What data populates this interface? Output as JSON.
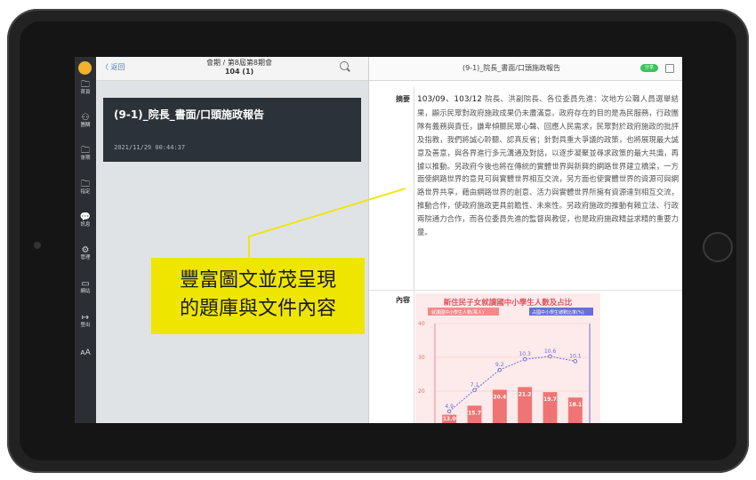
{
  "sidebar": {
    "items": [
      {
        "label": "首頁",
        "icon": "folder-icon"
      },
      {
        "label": "團購",
        "icon": "users-icon"
      },
      {
        "label": "會期",
        "icon": "folder-icon"
      },
      {
        "label": "指定",
        "icon": "folder-icon"
      },
      {
        "label": "訊息",
        "icon": "chat-icon"
      },
      {
        "label": "管理",
        "icon": "gear-icon"
      },
      {
        "label": "網站",
        "icon": "monitor-icon"
      },
      {
        "label": "登出",
        "icon": "logout-icon"
      },
      {
        "label": "",
        "icon": "font-size-icon"
      }
    ]
  },
  "list_header": {
    "back_label": "〈 返回",
    "breadcrumb_line1": "會期 / 第8屆第8期會",
    "breadcrumb_line2": "104 (1)"
  },
  "doc_card": {
    "title": "(9-1)_院長_書面/口頭施政報告",
    "date": "2021/11/29 00:44:37"
  },
  "detail": {
    "title": "(9-1)_院長_書面/口頭施政報告",
    "line_badge": "分享",
    "abstract_label": "摘要",
    "content_label": "內容",
    "abstract_lead": "103/09、103/12",
    "abstract_text": " 院長、洪副院長、各位委員先進：次地方公職人員選舉結果，顯示民眾對政府施政成果仍未盡滿意。政府存在的目的是為民服務，行政團隊有義務與責任，謙卑傾聽民眾心聲、回應人民需求，民眾對於政府施政的批評及指教，我們將誠心聆聽、認真反省；針對具重大爭議的政策，也將展現最大誠意及善意，與各界進行多元溝通及對話，以逐步凝聚並尋求政策的最大共識，再據以推動。另政府今後也將在傳統的實體世界與新興的網路世界建立橋梁，一方面使網路世界的意見可與實體世界相互交流，另方面也使實體世界的資源可與網路世界共享，藉由網路世界的創意、活力與實體世界所擁有資源達到相互交流，推動合作，使政府施政更具前瞻性、未來性。另政府施政的推動有賴立法、行政兩院通力合作，而各位委員先進的監督與教促，也是政府施政精益求精的重要力量。"
  },
  "chart_image": {
    "title": "新住民子女就讀國中小學生人數及占比",
    "legend_left": "就讀國中小學生人數(萬人)",
    "legend_right": "占國中小學生總數比率(%)"
  },
  "chart_data": {
    "type": "bar",
    "title": "新住民子女就讀國中小學生人數及占比",
    "series": [
      {
        "name": "就讀國中小學生人數(萬人)",
        "values": [
          13.0,
          15.7,
          20.4,
          21.2,
          19.7,
          18.1
        ]
      },
      {
        "name": "占國中小學生總數比率(%)",
        "values": [
          4.9,
          7.1,
          9.2,
          10.3,
          10.6,
          10.1
        ]
      }
    ],
    "bar_labels": [
      "13.0",
      "15.7",
      "20.4",
      "21.2",
      "19.7",
      "18.1"
    ],
    "line_labels": [
      "4.9",
      "7.1",
      "9.2",
      "10.3",
      "10.6",
      "10.1"
    ],
    "left_ticks": [
      "40",
      "30",
      "20",
      "10"
    ],
    "ylim_left": [
      0,
      40
    ],
    "ylim_right": [
      0,
      14
    ]
  },
  "callout": {
    "line1": "豐富圖文並茂呈現",
    "line2": "的題庫與文件內容",
    "color": "#efe600"
  }
}
